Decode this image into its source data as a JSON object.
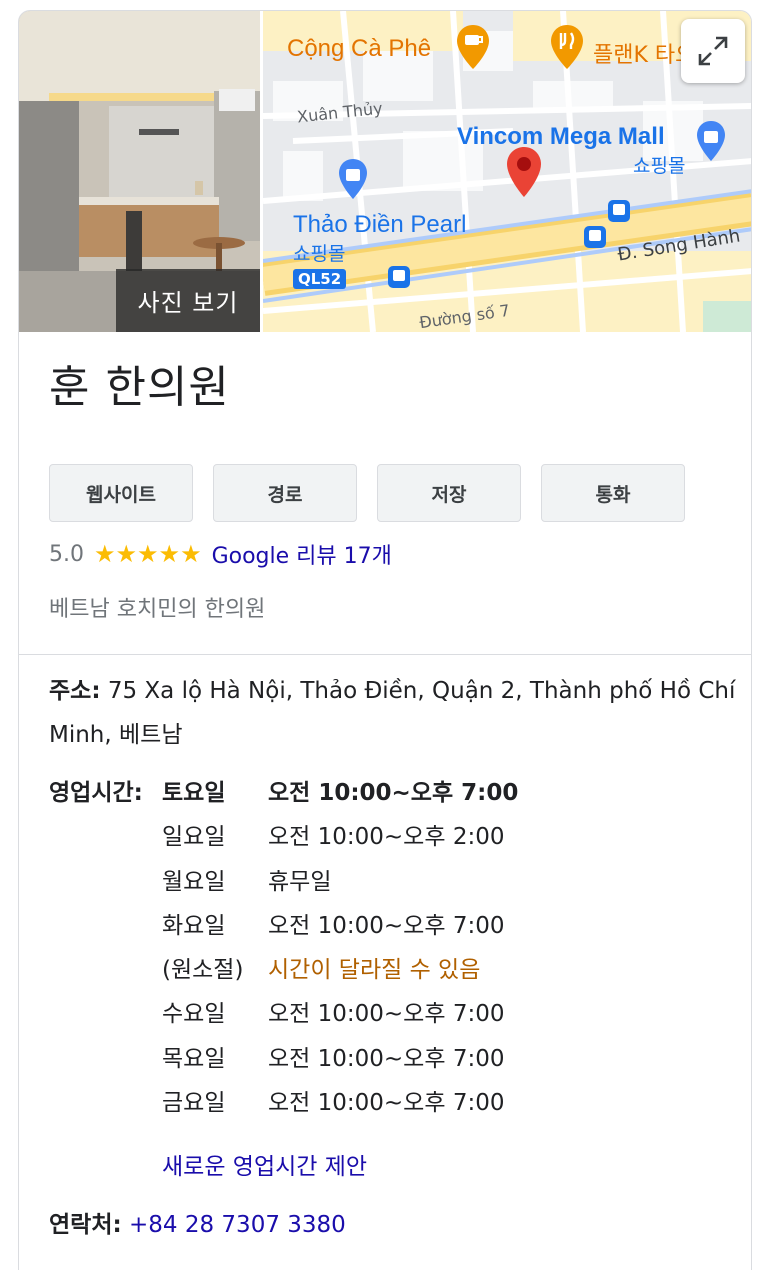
{
  "photo": {
    "button_label": "사진 보기"
  },
  "map": {
    "labels": {
      "cafe": "Cộng Cà Phê",
      "plank": "플랜K 타오디엔",
      "xuan_thuy": "Xuân Thủy",
      "vincom": "Vincom Mega Mall",
      "vincom_sub": "쇼핑몰",
      "thao_dien": "Thảo Điền Pearl",
      "thao_dien_sub": "쇼핑몰",
      "song_hanh": "Đ. Song Hành",
      "ql52": "QL52",
      "duong7": "Đường số 7"
    },
    "colors": {
      "blue_label": "#1a73e8",
      "orange_label": "#e37400",
      "pin": "#ea4335"
    }
  },
  "place": {
    "name": "훈 한의원",
    "rating": "5.0",
    "stars": "★★★★★",
    "reviews_link": "Google 리뷰 17개",
    "category": "베트남 호치민의 한의원"
  },
  "actions": {
    "website": "웹사이트",
    "directions": "경로",
    "save": "저장",
    "call": "통화"
  },
  "address": {
    "label": "주소:",
    "value": "75 Xa lộ Hà Nội, Thảo Điền, Quận 2, Thành phố Hồ Chí Minh, 베트남"
  },
  "hours": {
    "label": "영업시간:",
    "rows": [
      {
        "day": "토요일",
        "time": "오전 10:00~오후 7:00"
      },
      {
        "day": "일요일",
        "time": "오전 10:00~오후 2:00"
      },
      {
        "day": "월요일",
        "time": "휴무일"
      },
      {
        "day": "화요일",
        "time": "오전 10:00~오후 7:00"
      },
      {
        "day": "(원소절)",
        "time": "시간이 달라질 수 있음"
      },
      {
        "day": "수요일",
        "time": "오전 10:00~오후 7:00"
      },
      {
        "day": "목요일",
        "time": "오전 10:00~오후 7:00"
      },
      {
        "day": "금요일",
        "time": "오전 10:00~오후 7:00"
      }
    ],
    "suggest_link": "새로운 영업시간 제안"
  },
  "contact": {
    "label": "연락처:",
    "phone": "+84 28 7307 3380"
  }
}
